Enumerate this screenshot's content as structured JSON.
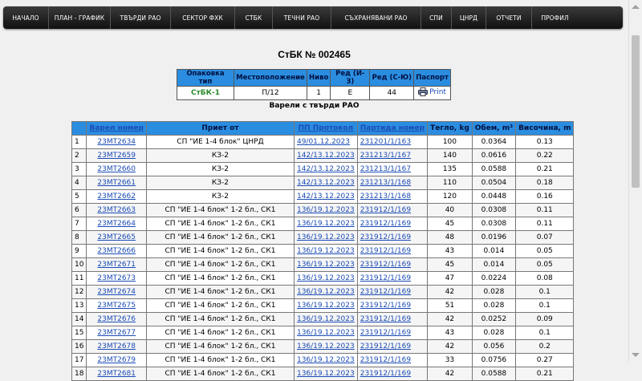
{
  "nav": [
    "НАЧАЛО",
    "ПЛАН - ГРАФИК",
    "ТВЪРДИ РАО",
    "СЕКТОР ФХК",
    "СТБК",
    "ТЕЧНИ РАО",
    "СЪХРАНЯВАНИ РАО",
    "СПИ",
    "ЦНРД",
    "ОТЧЕТИ",
    "ПРОФИЛ"
  ],
  "page_title": "СтБК № 002465",
  "info": {
    "headers": [
      "Опаковка тип",
      "Местоположение",
      "Ниво",
      "Ред (И-З)",
      "Ред (С-Ю)",
      "Паспорт"
    ],
    "values": [
      "СтБК-1",
      "П/12",
      "1",
      "Е",
      "44"
    ],
    "print_label": "Print"
  },
  "subtitle": "Варели с твърди РАО",
  "table": {
    "headers": [
      "",
      "Варел номер",
      "Приет от",
      "ПП Протокол",
      "Партида номер",
      "Тегло, kg",
      "Обем, m³",
      "Височина, m"
    ],
    "rows": [
      [
        "1",
        "23МТ2634",
        "СП \"ИЕ 1-4 блок\" ЦНРД",
        "49/01.12.2023",
        "231201/1/163",
        "100",
        "0.0364",
        "0.13"
      ],
      [
        "2",
        "23МТ2659",
        "КЗ-2",
        "142/13.12.2023",
        "231213/1/167",
        "140",
        "0.0616",
        "0.22"
      ],
      [
        "3",
        "23МТ2660",
        "КЗ-2",
        "142/13.12.2023",
        "231213/1/167",
        "135",
        "0.0588",
        "0.21"
      ],
      [
        "4",
        "23МТ2661",
        "КЗ-2",
        "142/13.12.2023",
        "231213/1/168",
        "110",
        "0.0504",
        "0.18"
      ],
      [
        "5",
        "23МТ2662",
        "КЗ-2",
        "142/13.12.2023",
        "231213/1/168",
        "120",
        "0.0448",
        "0.16"
      ],
      [
        "6",
        "23МТ2663",
        "СП \"ИЕ 1-4 блок\" 1-2 бл., СК1",
        "136/19.12.2023",
        "231912/1/169",
        "40",
        "0.0308",
        "0.11"
      ],
      [
        "7",
        "23МТ2664",
        "СП \"ИЕ 1-4 блок\" 1-2 бл., СК1",
        "136/19.12.2023",
        "231912/1/169",
        "45",
        "0.0308",
        "0.11"
      ],
      [
        "8",
        "23МТ2665",
        "СП \"ИЕ 1-4 блок\" 1-2 бл., СК1",
        "136/19.12.2023",
        "231912/1/169",
        "48",
        "0.0196",
        "0.07"
      ],
      [
        "9",
        "23МТ2666",
        "СП \"ИЕ 1-4 блок\" 1-2 бл., СК1",
        "136/19.12.2023",
        "231912/1/169",
        "43",
        "0.014",
        "0.05"
      ],
      [
        "10",
        "23МТ2671",
        "СП \"ИЕ 1-4 блок\" 1-2 бл., СК1",
        "136/19.12.2023",
        "231912/1/169",
        "45",
        "0.014",
        "0.05"
      ],
      [
        "11",
        "23МТ2673",
        "СП \"ИЕ 1-4 блок\" 1-2 бл., СК1",
        "136/19.12.2023",
        "231912/1/169",
        "47",
        "0.0224",
        "0.08"
      ],
      [
        "12",
        "23МТ2674",
        "СП \"ИЕ 1-4 блок\" 1-2 бл., СК1",
        "136/19.12.2023",
        "231912/1/169",
        "42",
        "0.028",
        "0.1"
      ],
      [
        "13",
        "23МТ2675",
        "СП \"ИЕ 1-4 блок\" 1-2 бл., СК1",
        "136/19.12.2023",
        "231912/1/169",
        "51",
        "0.028",
        "0.1"
      ],
      [
        "14",
        "23МТ2676",
        "СП \"ИЕ 1-4 блок\" 1-2 бл., СК1",
        "136/19.12.2023",
        "231912/1/169",
        "42",
        "0.0252",
        "0.09"
      ],
      [
        "15",
        "23МТ2677",
        "СП \"ИЕ 1-4 блок\" 1-2 бл., СК1",
        "136/19.12.2023",
        "231912/1/169",
        "43",
        "0.028",
        "0.1"
      ],
      [
        "16",
        "23МТ2678",
        "СП \"ИЕ 1-4 блок\" 1-2 бл., СК1",
        "136/19.12.2023",
        "231912/1/169",
        "42",
        "0.056",
        "0.2"
      ],
      [
        "17",
        "23МТ2679",
        "СП \"ИЕ 1-4 блок\" 1-2 бл., СК1",
        "136/19.12.2023",
        "231912/1/169",
        "33",
        "0.0756",
        "0.27"
      ],
      [
        "18",
        "23МТ2681",
        "СП \"ИЕ 1-4 блок\" 1-2 бл., СК1",
        "136/19.12.2023",
        "231912/1/169",
        "42",
        "0.0588",
        "0.21"
      ]
    ]
  }
}
